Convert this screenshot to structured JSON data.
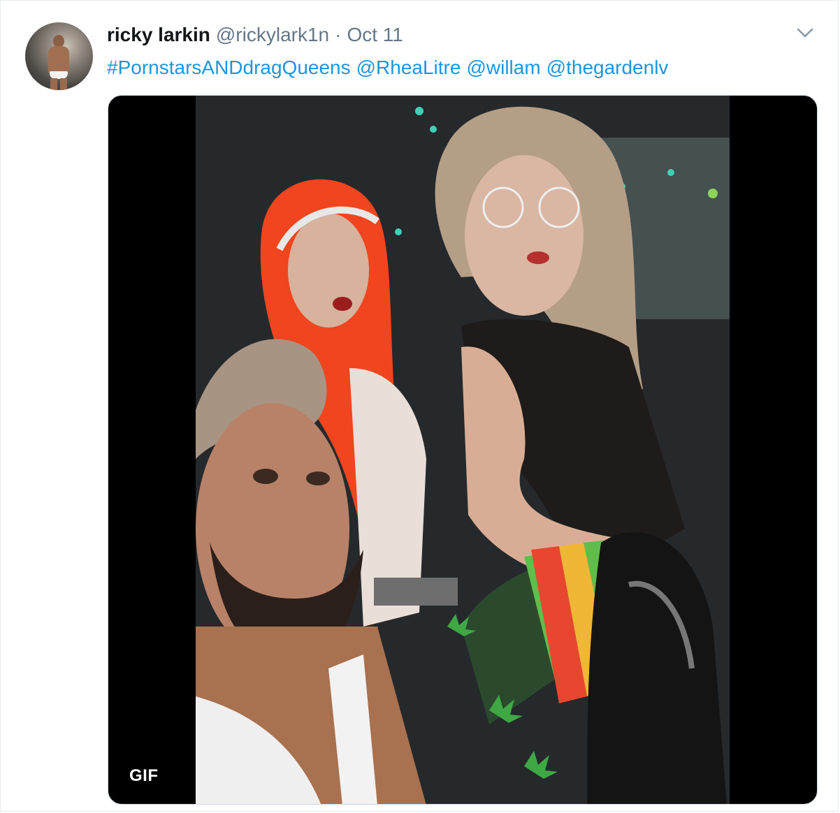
{
  "tweet": {
    "author_name": "ricky larkin",
    "author_handle": "@rickylark1n",
    "separator": "·",
    "date": "Oct 11",
    "text_parts": [
      "#PornstarsANDdragQueens",
      "@RheaLitre",
      "@willam",
      "@thegardenlv"
    ],
    "media_badge": "GIF"
  },
  "icons": {
    "menu": "chevron-down-icon"
  },
  "colors": {
    "link": "#1b95e0",
    "name": "#14171a",
    "secondary": "#657786",
    "border": "#e6ecf0"
  }
}
